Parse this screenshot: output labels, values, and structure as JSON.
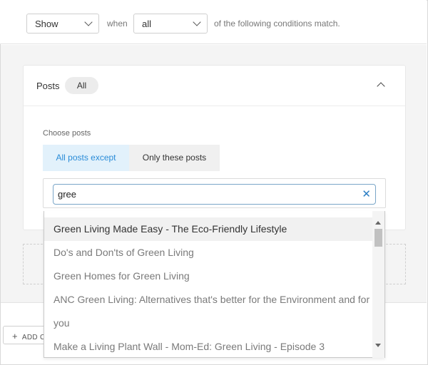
{
  "conditions": {
    "action_select": "Show",
    "when_text": "when",
    "match_select": "all",
    "suffix_text": "of the following conditions match."
  },
  "posts_card": {
    "label": "Posts",
    "pill": "All",
    "choose_label": "Choose posts",
    "tabs": [
      "All posts except",
      "Only these posts"
    ],
    "search_value": "gree",
    "clear_icon": "close-icon"
  },
  "dropdown": {
    "items": [
      "Green Living Made Easy - The Eco-Friendly Lifestyle",
      "Do's and Don'ts of Green Living",
      "Green Homes for Green Living",
      "ANC Green Living: Alternatives that's better for the Environment and for",
      "you",
      "Make a Living Plant Wall - Mom-Ed: Green Living - Episode 3"
    ]
  },
  "footer": {
    "add_label": "ADD C"
  },
  "colors": {
    "accent": "#2a8cd8",
    "active_tab_bg": "#e2f1fb",
    "grey_bg": "#f4f4f4"
  }
}
